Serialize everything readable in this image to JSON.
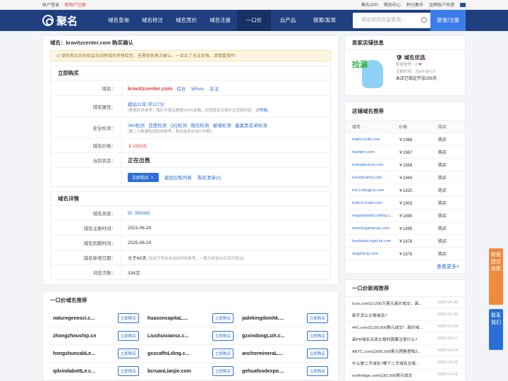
{
  "topbar": {
    "left_a": "账户登录",
    "left_b": "新用户注册",
    "right": [
      "聚名APP",
      "帮助中心",
      "积分集市",
      "金牌账户申请"
    ]
  },
  "nav": {
    "logo": "聚名",
    "items": [
      "域名查询",
      "域名抢注",
      "域名竞价",
      "域名注册",
      "一口价",
      "云产品",
      "探索/发现"
    ],
    "search_placeholder": "域名综合信息查询...",
    "login": "登录/注册"
  },
  "main": {
    "title": "域名：kravitzcenter.com 购买确认",
    "notice": "域名购买后系统会自动把域名转移给您，无需卖家再次确认，一旦买了无法反悔，请慎重操作!",
    "buy_title": "立即购买",
    "rows": {
      "name_k": "域名：",
      "name_v": "kravitzcenter.com",
      "name_links": [
        "综合",
        "Whois",
        "关注"
      ],
      "attr_k": "域名属性：",
      "attr_v": "建站21年,评117分",
      "attr_note": "(数据仅供参考，我们不保证数据100%准确。如违规名交易存在违规内容，请",
      "attr_report": "举报)",
      "check_k": "安全检测：",
      "checks": [
        "360检测",
        "百度检测",
        "QQ检测",
        "微信检测",
        "被墙检测",
        "备案黑名单检测"
      ],
      "check_note": "(第三方数据检测仅供参考，购买前务必自行判断)",
      "price_k": "域名价格：",
      "price_v": "￥1583元",
      "status_k": "当前状态：",
      "status_v": "正在出售",
      "buy_btn": "立即购买",
      "back": "返回出售列表",
      "cart": "购买清单(0)"
    },
    "detail_title": "域名详情",
    "details": [
      {
        "k": "域名卖家：",
        "v": "ID: 956382"
      },
      {
        "k": "域名注册时间：",
        "v": "2023-06-29"
      },
      {
        "k": "域名到期时间：",
        "v": "2025-06-29"
      },
      {
        "k": "域名新增日期：",
        "v": "大于60天",
        "note": "(仅用于转出本站的时间参考，一般为持有60天后可转出)"
      },
      {
        "k": "浏览次数：",
        "v": "334次"
      }
    ],
    "rec_title": "一口价域名推荐",
    "rec_btn": "立即购买",
    "rec": [
      "naturegenesci.c...",
      "huasoncapitaL....",
      "jadekingdomhk....",
      "zhongzhouship.cn",
      "Liushuixiansx.c...",
      "gzxindongLizh.c...",
      "hongshuncabLe...",
      "gxscaffoLding.c...",
      "anchormineraL....",
      "qdxindabottLe.c...",
      "bcruanLianjie.com",
      "gehuafoodexpo...."
    ]
  },
  "side": {
    "seller_title": "卖家店铺信息",
    "shop": "域名优选",
    "credit_k": "卖家信誉：",
    "credit_v": "0",
    "reg_k": "注册时间：",
    "reg_v": "2024-08-19",
    "stat": "本店已稳定开张256天",
    "rec_title": "店铺域名推荐",
    "cols": [
      "域名",
      "价格",
      "购买"
    ],
    "buy": "购买",
    "list": [
      [
        "triathLon44.com",
        "￥1968"
      ],
      [
        "handpm.com",
        "￥1967"
      ],
      [
        "truteqdevices.com",
        "￥1958"
      ],
      [
        "turrettyranny.com",
        "￥1949"
      ],
      [
        "truLLinpugLia.com",
        "￥1920"
      ],
      [
        "turkLe-cLark.com",
        "￥1903"
      ],
      [
        "vegasbrandcLothing.c...",
        "￥1899"
      ],
      [
        "treesongshaman.com",
        "￥1895"
      ],
      [
        "tusdudasLegaLes.com",
        "￥1876"
      ],
      [
        "vingerkLip.com",
        "￥1876"
      ]
    ],
    "more": "查看更多+",
    "news_title": "一口价新闻推荐",
    "news": [
      [
        "Icon.com以1200万美元高价成交，高...",
        "2025-04-30"
      ],
      [
        "新手怎么交易域名?",
        "2025-04-30"
      ],
      [
        "441.com以139,000美元成交！高价域...",
        "2025-04-29"
      ],
      [
        "高PR域名买卖交易时需要注意什么?",
        "2025-04-27"
      ],
      [
        "ABTC.com以699,999美元预售登陆2...",
        "2025-04-24"
      ],
      [
        "什么是二手域名?哪个二手域名交易...",
        "2025-04-23"
      ],
      [
        "northridge.com以82,500美元成交",
        "2025-04-22"
      ],
      [
        "什么是老域名?需要有大量老域名...",
        "2025-04-21"
      ]
    ]
  },
  "floats": {
    "a": "新版建议收集",
    "b": "联系我们"
  },
  "colors": {
    "nav": "#1f3f7f",
    "accent": "#2a6fd6",
    "price": "#e4393c",
    "float_a": "#f08a3c",
    "float_b": "#2a6fd6"
  }
}
